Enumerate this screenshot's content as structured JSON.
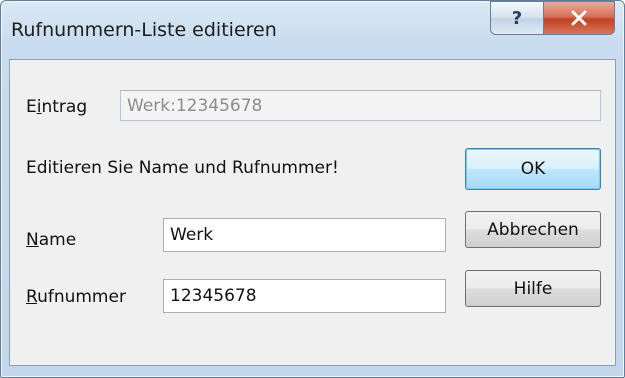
{
  "window": {
    "title": "Rufnummern-Liste editieren",
    "help_glyph": "?",
    "close_glyph": "✕"
  },
  "entry": {
    "label_pre": "E",
    "label_accel": "i",
    "label_post": "ntrag",
    "value": "Werk:12345678"
  },
  "instruction": "Editieren Sie Name und Rufnummer!",
  "name_field": {
    "label_accel": "N",
    "label_post": "ame",
    "value": "Werk"
  },
  "number_field": {
    "label_accel": "R",
    "label_post": "ufnummer",
    "value": "12345678"
  },
  "buttons": {
    "ok": "OK",
    "cancel": "Abbrechen",
    "help": "Hilfe"
  }
}
